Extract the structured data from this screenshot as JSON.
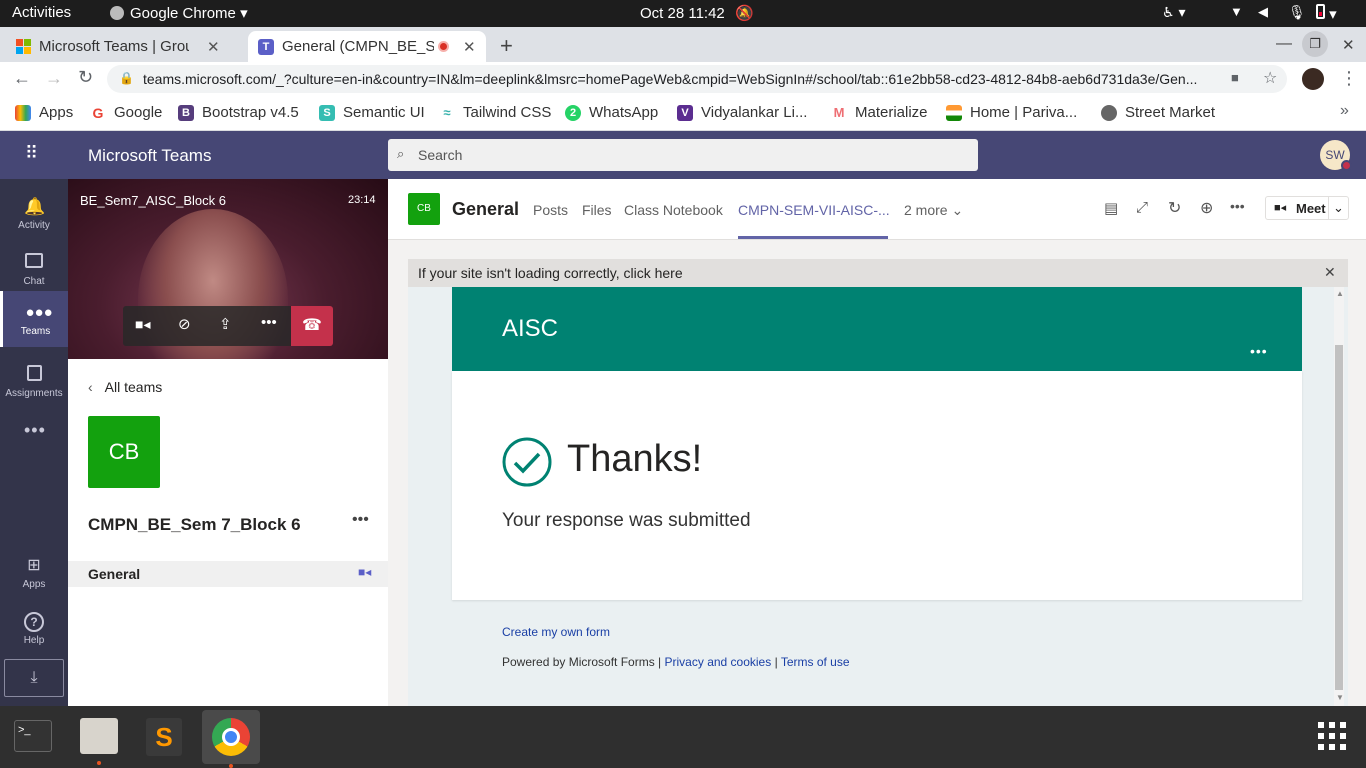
{
  "system_bar": {
    "activities": "Activities",
    "app_name": "Google Chrome",
    "datetime": "Oct 28  11:42"
  },
  "browser": {
    "tabs": [
      {
        "title": "Microsoft Teams | Group C",
        "active": false
      },
      {
        "title": "General (CMPN_BE_Se",
        "active": true
      }
    ],
    "url": "teams.microsoft.com/_?culture=en-in&country=IN&lm=deeplink&lmsrc=homePageWeb&cmpid=WebSignIn#/school/tab::61e2bb58-cd23-4812-84b8-aeb6d731da3e/Gen...",
    "bookmarks": [
      {
        "label": "Apps",
        "color": "#4285f4"
      },
      {
        "label": "Google",
        "color": "#ea4335"
      },
      {
        "label": "Bootstrap v4.5",
        "color": "#563d7c"
      },
      {
        "label": "Semantic UI",
        "color": "#35bdb2"
      },
      {
        "label": "Tailwind CSS",
        "color": "#38b2ac"
      },
      {
        "label": "WhatsApp",
        "color": "#25d366"
      },
      {
        "label": "Vidyalankar Li...",
        "color": "#5b2d90"
      },
      {
        "label": "Materialize",
        "color": "#ee6e73"
      },
      {
        "label": "Home | Pariva...",
        "color": "#ff9933"
      },
      {
        "label": "Street Market",
        "color": "#555555"
      }
    ]
  },
  "teams": {
    "app_title": "Microsoft Teams",
    "search_placeholder": "Search",
    "avatar": "SW",
    "rail": [
      {
        "label": "Activity",
        "icon": "bell-icon"
      },
      {
        "label": "Chat",
        "icon": "chat-icon"
      },
      {
        "label": "Teams",
        "icon": "teams-icon",
        "active": true
      },
      {
        "label": "Assignments",
        "icon": "assignments-icon"
      },
      {
        "label": "",
        "icon": "more-icon"
      },
      {
        "label": "Apps",
        "icon": "apps-icon"
      },
      {
        "label": "Help",
        "icon": "help-icon"
      }
    ],
    "call": {
      "meeting_name": "BE_Sem7_AISC_Block 6",
      "duration": "23:14"
    },
    "all_teams": "All teams",
    "team_badge": "CB",
    "team_name": "CMPN_BE_Sem 7_Block 6",
    "channel": "General",
    "channel_header": {
      "badge": "CB",
      "title": "General",
      "tabs": [
        "Posts",
        "Files",
        "Class Notebook",
        "CMPN-SEM-VII-AISC-...",
        "2 more"
      ],
      "active_tab": 3,
      "meet_label": "Meet"
    },
    "notice": "If your site isn't loading correctly, click here",
    "form": {
      "title": "AISC",
      "thanks": "Thanks!",
      "submitted": "Your response was submitted",
      "create_link": "Create my own form",
      "powered": "Powered by Microsoft Forms |",
      "privacy": "Privacy and cookies",
      "sep": "|",
      "terms": "Terms of use",
      "accent": "#008272"
    }
  },
  "colors": {
    "teams_purple": "#464775",
    "rail_bg": "#33344a",
    "team_green": "#13a10e",
    "hangup": "#c4314b"
  }
}
